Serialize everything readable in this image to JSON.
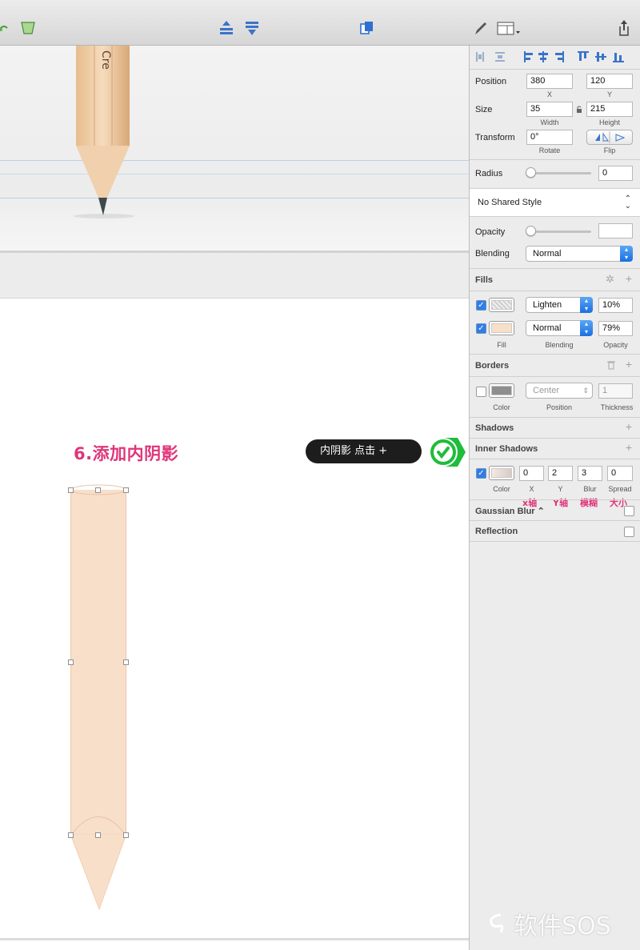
{
  "toolbar": {
    "icons": [
      "mask-icon",
      "scissors-icon",
      "move-forward-icon",
      "move-backward-icon",
      "group-icon",
      "pen-icon",
      "view-icon",
      "export-icon"
    ]
  },
  "canvas": {
    "step_label": "6.添加内阴影",
    "callout_text": "内阴影  点击 +",
    "pencil_logo": "Cre"
  },
  "inspector": {
    "position": {
      "label": "Position",
      "x": "380",
      "y": "120",
      "x_label": "X",
      "y_label": "Y"
    },
    "size": {
      "label": "Size",
      "width": "35",
      "height": "215",
      "width_label": "Width",
      "height_label": "Height"
    },
    "transform": {
      "label": "Transform",
      "rotate": "0°",
      "rotate_label": "Rotate",
      "flip_label": "Flip"
    },
    "radius": {
      "label": "Radius",
      "value": "0"
    },
    "shared_style": "No Shared Style",
    "opacity": {
      "label": "Opacity",
      "value": ""
    },
    "blending": {
      "label": "Blending",
      "value": "Normal"
    },
    "fills": {
      "title": "Fills",
      "items": [
        {
          "enabled": true,
          "blending": "Lighten",
          "opacity": "10%"
        },
        {
          "enabled": true,
          "blending": "Normal",
          "opacity": "79%",
          "color": "#f8dfca"
        }
      ],
      "fill_label": "Fill",
      "blending_label": "Blending",
      "opacity_label": "Opacity"
    },
    "borders": {
      "title": "Borders",
      "enabled": false,
      "position": "Center",
      "thickness": "1",
      "color_label": "Color",
      "position_label": "Position",
      "thickness_label": "Thickness"
    },
    "shadows": {
      "title": "Shadows"
    },
    "inner_shadows": {
      "title": "Inner Shadows",
      "enabled": true,
      "x": "0",
      "y": "2",
      "blur": "3",
      "spread": "0",
      "color_label": "Color",
      "x_label": "X",
      "y_label": "Y",
      "blur_label": "Blur",
      "spread_label": "Spread",
      "annotations": [
        "x轴",
        "Y轴",
        "模糊",
        "大小"
      ]
    },
    "gaussian_blur": {
      "title": "Gaussian Blur ⌃"
    },
    "reflection": {
      "title": "Reflection"
    }
  },
  "watermark": "软件SOS",
  "colors": {
    "accent": "#e0357a",
    "pencil_fill": "#f8dfca",
    "check_green": "#1ebd3a",
    "select_blue": "#1a6fe0"
  }
}
